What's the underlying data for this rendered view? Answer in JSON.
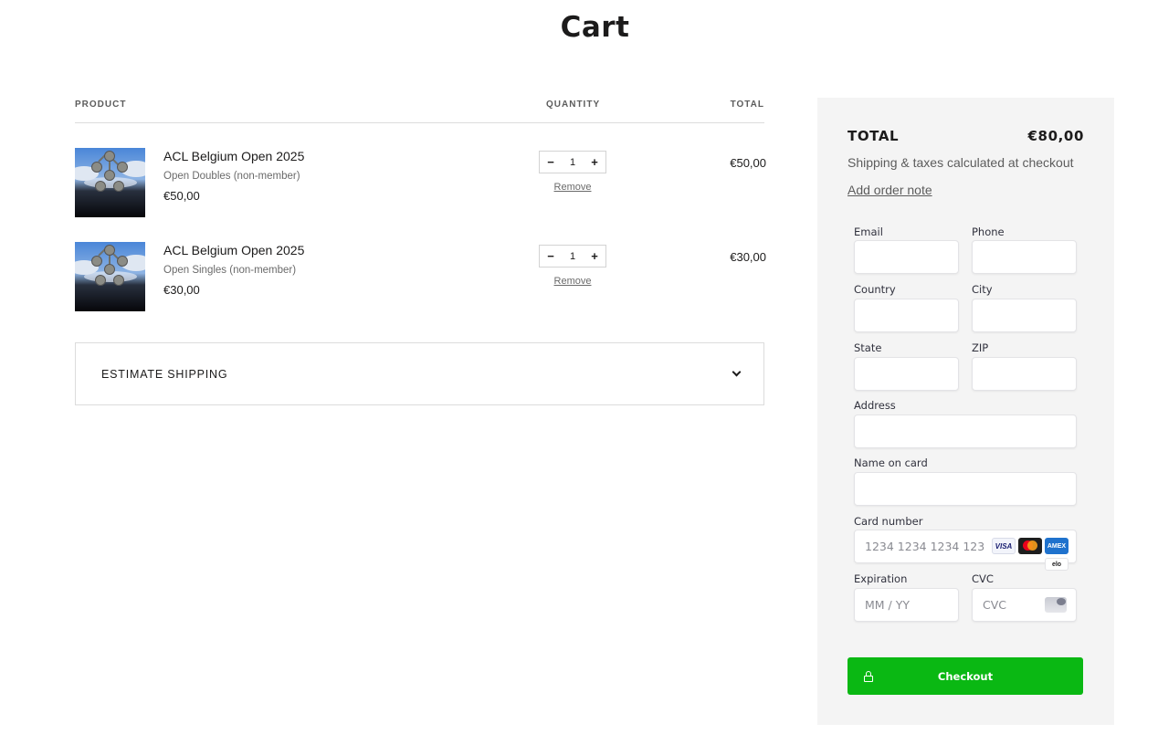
{
  "page": {
    "title": "Cart"
  },
  "table": {
    "headers": {
      "product": "PRODUCT",
      "quantity": "QUANTITY",
      "total": "TOTAL"
    },
    "remove_label": "Remove",
    "items": [
      {
        "title": "ACL Belgium Open 2025",
        "variant": "Open Doubles (non-member)",
        "price": "€50,00",
        "quantity": "1",
        "line_total": "€50,00"
      },
      {
        "title": "ACL Belgium Open 2025",
        "variant": "Open Singles (non-member)",
        "price": "€30,00",
        "quantity": "1",
        "line_total": "€30,00"
      }
    ]
  },
  "estimate_shipping": {
    "label": "ESTIMATE SHIPPING"
  },
  "summary": {
    "total_label": "TOTAL",
    "total_value": "€80,00",
    "note": "Shipping & taxes calculated at checkout",
    "add_order_note": "Add order note"
  },
  "form": {
    "email": {
      "label": "Email",
      "value": "",
      "placeholder": ""
    },
    "phone": {
      "label": "Phone",
      "value": "",
      "placeholder": ""
    },
    "country": {
      "label": "Country",
      "value": "",
      "placeholder": ""
    },
    "city": {
      "label": "City",
      "value": "",
      "placeholder": ""
    },
    "state": {
      "label": "State",
      "value": "",
      "placeholder": ""
    },
    "zip": {
      "label": "ZIP",
      "value": "",
      "placeholder": ""
    },
    "address": {
      "label": "Address",
      "value": "",
      "placeholder": ""
    },
    "name_on_card": {
      "label": "Name on card",
      "value": "",
      "placeholder": ""
    },
    "card_number": {
      "label": "Card number",
      "value": "",
      "placeholder": "1234 1234 1234 1234"
    },
    "expiration": {
      "label": "Expiration",
      "value": "",
      "placeholder": "MM / YY"
    },
    "cvc": {
      "label": "CVC",
      "value": "",
      "placeholder": "CVC"
    }
  },
  "card_brands": [
    "VISA",
    "mastercard",
    "AMEX",
    "elo"
  ],
  "checkout": {
    "label": "Checkout",
    "color": "#0ab813"
  },
  "icons": {
    "minus": "−",
    "plus": "+",
    "chevron": "chevron-down-icon",
    "lock": "lock-icon"
  }
}
